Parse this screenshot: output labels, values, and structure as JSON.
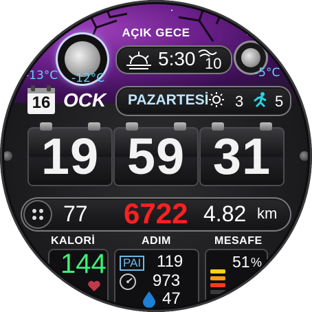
{
  "header": {
    "title": "AÇIK GECE"
  },
  "weather": {
    "sun_time": "5:30",
    "uv_value": "10",
    "temp_low": "-13°C",
    "temp_current": "-12°C",
    "temp_right": "-5°C"
  },
  "date": {
    "day": "16",
    "month": "OCK",
    "weekday": "PAZARTESİ",
    "uv_index": "3",
    "activity_count": "5"
  },
  "time": {
    "hours": "19",
    "minutes": "59",
    "seconds": "31"
  },
  "stats": {
    "calories_small": "77",
    "steps": "6722",
    "distance": "4.82",
    "distance_unit": "km"
  },
  "labels": {
    "calories": "KALORİ",
    "steps": "ADIM",
    "distance": "MESAFE"
  },
  "bottom": {
    "calories_value": "144",
    "pai_label": "PAI",
    "pai_value": "119",
    "metric_value": "973",
    "water_value": "47",
    "battery_percent": "51",
    "battery_unit": "%"
  },
  "colors": {
    "steps": "#ff2020",
    "calories_value": "#3df07a",
    "weekday": "#bfe6ff",
    "activity": "#25d3e6",
    "temp": "#5fd2ff"
  }
}
